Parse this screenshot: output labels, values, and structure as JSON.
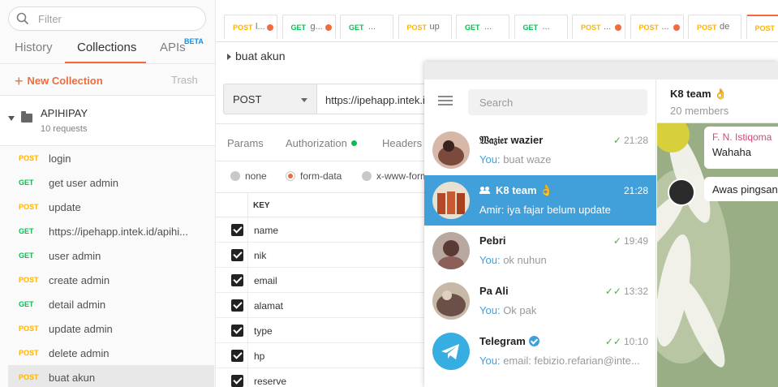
{
  "sidebar": {
    "filter_placeholder": "Filter",
    "tabs": {
      "history": "History",
      "collections": "Collections",
      "apis": "APIs",
      "apis_badge": "BETA"
    },
    "new_collection": "New Collection",
    "trash": "Trash",
    "collection": {
      "name": "APIHIPAY",
      "count": "10 requests"
    },
    "requests": [
      {
        "method": "POST",
        "name": "login"
      },
      {
        "method": "GET",
        "name": "get user admin"
      },
      {
        "method": "POST",
        "name": "update"
      },
      {
        "method": "GET",
        "name": "https://ipehapp.intek.id/apihi..."
      },
      {
        "method": "GET",
        "name": "user admin"
      },
      {
        "method": "POST",
        "name": "create admin"
      },
      {
        "method": "GET",
        "name": "detail admin"
      },
      {
        "method": "POST",
        "name": "update admin"
      },
      {
        "method": "POST",
        "name": "delete admin"
      },
      {
        "method": "POST",
        "name": "buat akun"
      }
    ]
  },
  "tabs": [
    {
      "method": "POST",
      "title": "l...",
      "dot": true
    },
    {
      "method": "GET",
      "title": "g...",
      "dot": true
    },
    {
      "method": "GET",
      "title": "...",
      "dot": false
    },
    {
      "method": "POST",
      "title": "up",
      "dot": false
    },
    {
      "method": "GET",
      "title": "...",
      "dot": false
    },
    {
      "method": "GET",
      "title": "...",
      "dot": false
    },
    {
      "method": "POST",
      "title": "...",
      "dot": true
    },
    {
      "method": "POST",
      "title": "...",
      "dot": true
    },
    {
      "method": "POST",
      "title": "de",
      "dot": false
    },
    {
      "method": "POST",
      "title": "",
      "dot": false
    }
  ],
  "request": {
    "title": "buat akun",
    "method": "POST",
    "url": "https://ipehapp.intek.id"
  },
  "subtabs": {
    "params": "Params",
    "authorization": "Authorization",
    "headers": "Headers"
  },
  "body_types": {
    "none": "none",
    "form_data": "form-data",
    "x_www": "x-www-form-urlencoded"
  },
  "kv": {
    "key_header": "KEY",
    "keys": [
      "name",
      "nik",
      "email",
      "alamat",
      "type",
      "hp",
      "reserve"
    ]
  },
  "telegram": {
    "search_placeholder": "Search",
    "chats": [
      {
        "name": "𝔚𝔞𝔷𝔦𝔢𝔯 wazier",
        "time": "21:28",
        "who": "You:",
        "msg": "buat waze",
        "check": "✓"
      },
      {
        "name": "K8 team 👌",
        "time": "21:28",
        "who": "Amir:",
        "msg": "iya fajar belum update",
        "check": ""
      },
      {
        "name": "Pebri",
        "time": "19:49",
        "who": "You:",
        "msg": "ok nuhun",
        "check": "✓"
      },
      {
        "name": "Pa Ali",
        "time": "13:32",
        "who": "You:",
        "msg": "Ok pak",
        "check": "✓✓"
      },
      {
        "name": "Telegram",
        "time": "10:10",
        "who": "You:",
        "msg": "email:   febizio.refarian@inte...",
        "check": "✓✓"
      }
    ],
    "group": {
      "name": "K8 team 👌",
      "members": "20 members"
    },
    "messages": [
      {
        "sender": "F. N. Istiqoma",
        "text": "Wahaha"
      },
      {
        "sender": "",
        "text": "Awas pingsan"
      }
    ]
  }
}
